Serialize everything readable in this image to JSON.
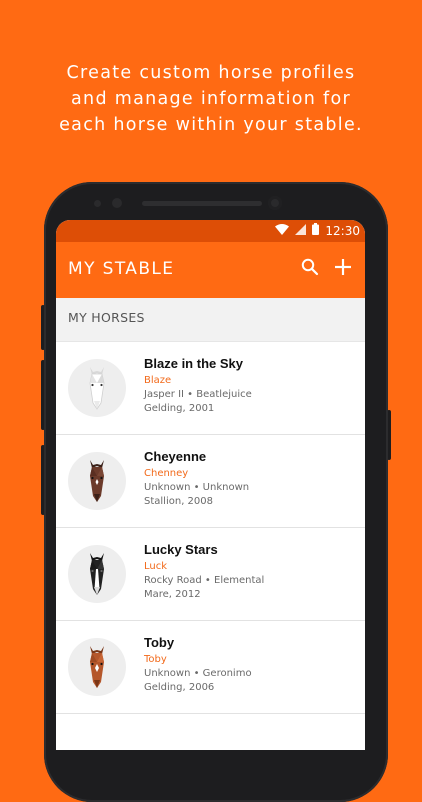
{
  "headline": {
    "line1": "Create custom horse profiles",
    "line2": "and manage information for",
    "line3": "each horse within your stable."
  },
  "status_bar": {
    "time": "12:30"
  },
  "app_bar": {
    "title": "MY STABLE"
  },
  "section": {
    "label": "MY HORSES"
  },
  "horses": [
    {
      "name": "Blaze in the Sky",
      "nickname": "Blaze",
      "parents": "Jasper II • Beatlejuice",
      "details": "Gelding, 2001",
      "coat_color": "#F4F4F4",
      "marking": "white"
    },
    {
      "name": "Cheyenne",
      "nickname": "Chenney",
      "parents": "Unknown • Unknown",
      "details": "Stallion, 2008",
      "coat_color": "#6B3A2A",
      "marking": "star"
    },
    {
      "name": "Lucky Stars",
      "nickname": "Luck",
      "parents": "Rocky Road • Elemental",
      "details": "Mare, 2012",
      "coat_color": "#222222",
      "marking": "blaze"
    },
    {
      "name": "Toby",
      "nickname": "Toby",
      "parents": "Unknown • Geronimo",
      "details": "Gelding, 2006",
      "coat_color": "#B5572B",
      "marking": "star"
    }
  ],
  "colors": {
    "brand": "#FF6A13",
    "status_bar": "#DD4E06",
    "nickname": "#F26A1B"
  }
}
